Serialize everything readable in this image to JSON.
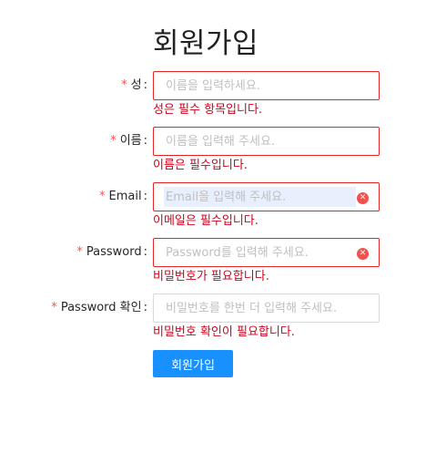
{
  "page": {
    "title": "회원가입"
  },
  "fields": [
    {
      "label": "성",
      "required_mark": "*",
      "colon": ":",
      "placeholder": "이름을 입력하세요.",
      "value": "",
      "error": "성은 필수 항목입니다."
    },
    {
      "label": "이름",
      "required_mark": "*",
      "colon": ":",
      "placeholder": "이름을 입력해 주세요.",
      "value": "",
      "error": "이름은 필수입니다."
    },
    {
      "label": "Email",
      "required_mark": "*",
      "colon": ":",
      "placeholder": "Email을 입력해 주세요.",
      "value": "",
      "error": "이메일은 필수입니다.",
      "clear_icon": "clear-circle-icon"
    },
    {
      "label": "Password",
      "required_mark": "*",
      "colon": ":",
      "placeholder": "Password를 입력해 주세요.",
      "value": "",
      "error": "비밀번호가 필요합니다.",
      "clear_icon": "clear-circle-icon"
    },
    {
      "label": "Password 확인",
      "required_mark": "*",
      "colon": ":",
      "placeholder": "비밀번호를 한번 더 입력해 주세요.",
      "value": "",
      "error": "비밀번호 확인이 필요합니다."
    }
  ],
  "submit": {
    "label": "회원가입"
  },
  "colors": {
    "error": "#d0021b",
    "error_border": "#e32525",
    "primary": "#1890ff",
    "required_star": "#ff4d4f"
  }
}
